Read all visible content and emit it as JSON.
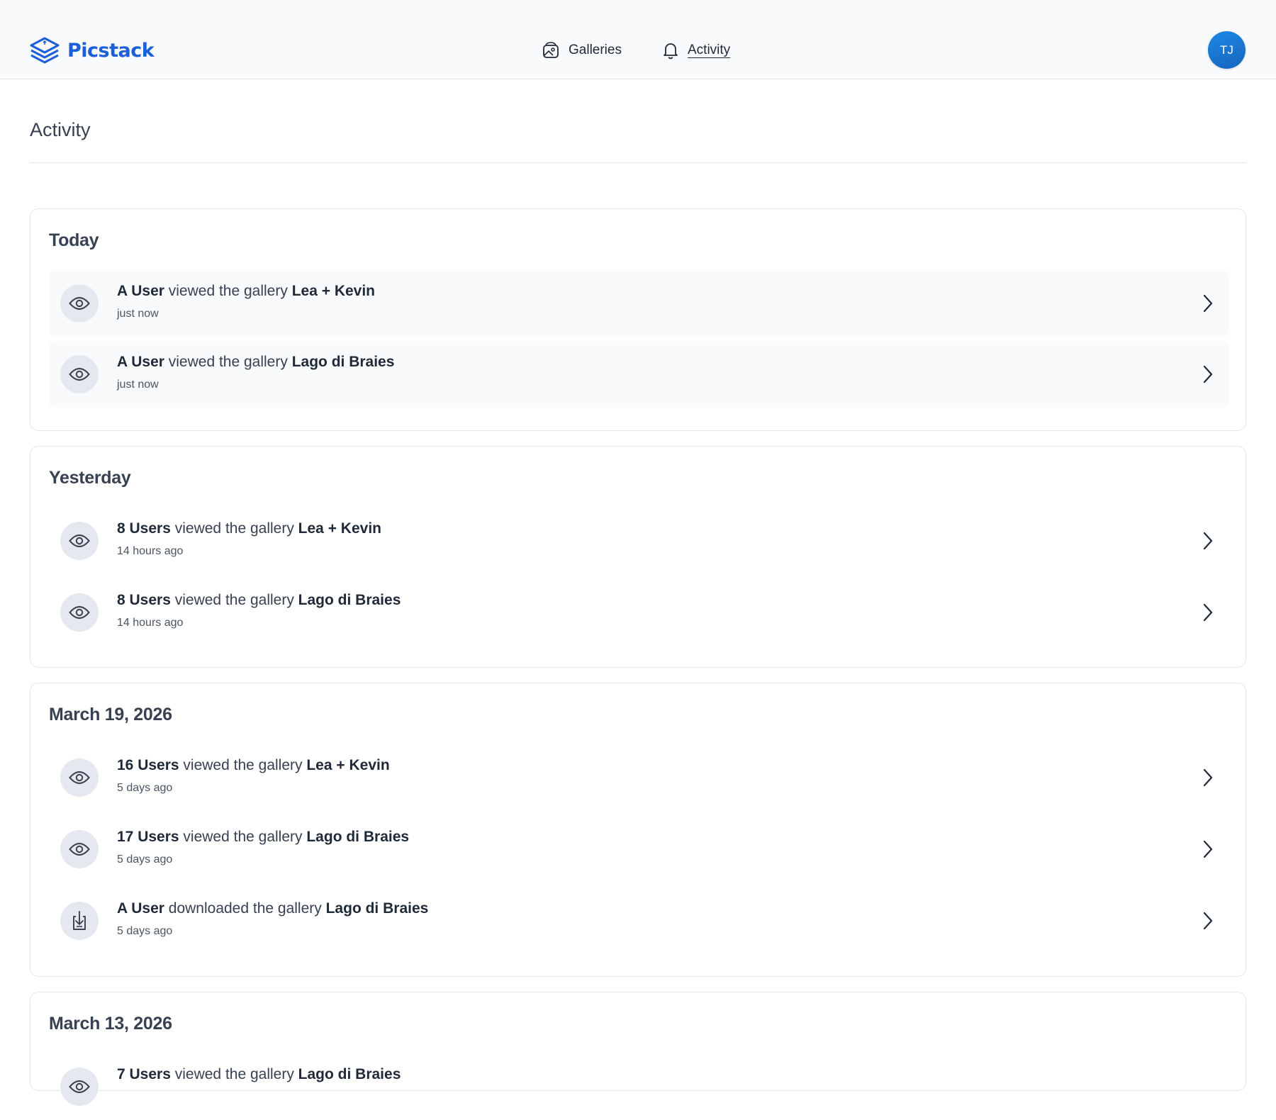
{
  "header": {
    "brand": "Picstack",
    "nav": {
      "galleries": "Galleries",
      "activity": "Activity"
    },
    "avatar_initials": "TJ"
  },
  "page": {
    "title": "Activity"
  },
  "groups": [
    {
      "heading": "Today",
      "items": [
        {
          "actor": "A User",
          "verb": "viewed the gallery",
          "gallery": "Lea + Kevin",
          "time": "just now",
          "icon": "eye-icon"
        },
        {
          "actor": "A User",
          "verb": "viewed the gallery",
          "gallery": "Lago di Braies",
          "time": "just now",
          "icon": "eye-icon"
        }
      ]
    },
    {
      "heading": "Yesterday",
      "items": [
        {
          "actor": "8 Users",
          "verb": "viewed the gallery",
          "gallery": "Lea + Kevin",
          "time": "14 hours ago",
          "icon": "eye-icon"
        },
        {
          "actor": "8 Users",
          "verb": "viewed the gallery",
          "gallery": "Lago di Braies",
          "time": "14 hours ago",
          "icon": "eye-icon"
        }
      ]
    },
    {
      "heading": "March 19, 2026",
      "items": [
        {
          "actor": "16 Users",
          "verb": "viewed the gallery",
          "gallery": "Lea + Kevin",
          "time": "5 days ago",
          "icon": "eye-icon"
        },
        {
          "actor": "17 Users",
          "verb": "viewed the gallery",
          "gallery": "Lago di Braies",
          "time": "5 days ago",
          "icon": "eye-icon"
        },
        {
          "actor": "A User",
          "verb": "downloaded the gallery",
          "gallery": "Lago di Braies",
          "time": "5 days ago",
          "icon": "download-icon"
        }
      ]
    },
    {
      "heading": "March 13, 2026",
      "items": [
        {
          "actor": "7 Users",
          "verb": "viewed the gallery",
          "gallery": "Lago di Braies",
          "time": "",
          "icon": "eye-icon"
        }
      ]
    }
  ],
  "colors": {
    "brand": "#1d5fd6",
    "avatar": "#1e88e5",
    "row_shade": "#f8fafc"
  }
}
